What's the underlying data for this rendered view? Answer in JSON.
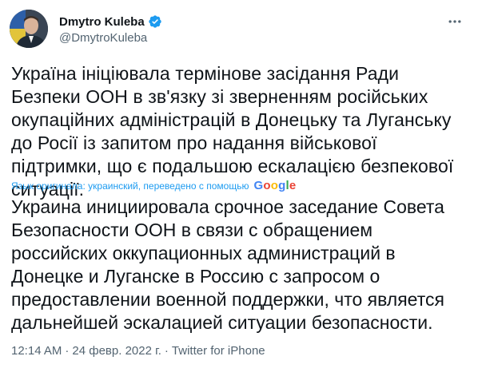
{
  "author": {
    "display_name": "Dmytro Kuleba",
    "handle": "@DmytroKuleba",
    "verified": true,
    "verified_color": "#1d9bf0",
    "avatar_icon": "profile-photo-avatar"
  },
  "tweet": {
    "original_text": "Україна ініціювала термінове засідання Ради Безпеки ООН в зв'язку зі зверненням російських окупаційних адміністрацій в Донецьку та Луганську до Росії із запитом про надання військової підтримки, що є подальшою ескалацією безпекової ситуації.",
    "translation_note": "Язык оригинала: украинский, переведено с помощью",
    "translation_provider": {
      "letters": [
        "G",
        "o",
        "o",
        "g",
        "l",
        "e"
      ],
      "colors": [
        "#4285f4",
        "#ea4335",
        "#fbbc05",
        "#4285f4",
        "#34a853",
        "#ea4335"
      ]
    },
    "translated_text": "Украина инициировала срочное заседание Совета Безопасности ООН в связи с обращением российских оккупационных администраций в Донецке и Луганске в Россию с запросом о предоставлении военной поддержки, что является дальнейшей эскалацией ситуации безопасности.",
    "time": "12:14 AM",
    "separator": "·",
    "date": "24 февр. 2022 г.",
    "source": "Twitter for iPhone"
  },
  "icons": {
    "more": "more-horizontal-icon",
    "verified": "verified-badge-icon"
  },
  "colors": {
    "text": "#0f1419",
    "secondary": "#536471",
    "accent": "#1d9bf0"
  }
}
